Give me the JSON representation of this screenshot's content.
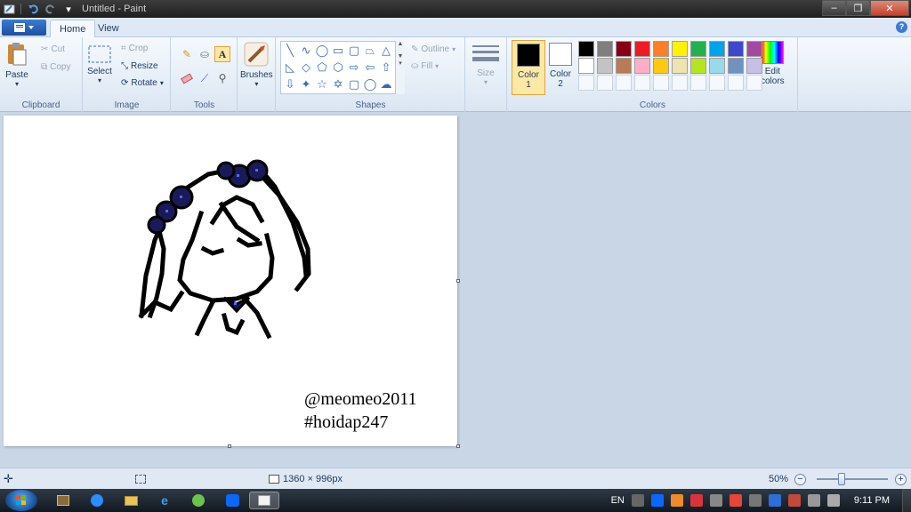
{
  "titlebar": {
    "title": "Untitled - Paint",
    "controls": [
      "minimize-icon",
      "restore-icon",
      "close-icon"
    ]
  },
  "tabs": [
    {
      "label": "Home",
      "active": true
    },
    {
      "label": "View",
      "active": false
    }
  ],
  "ribbon": {
    "clipboard": {
      "label": "Clipboard",
      "paste": "Paste",
      "cut": "Cut",
      "copy": "Copy"
    },
    "image": {
      "label": "Image",
      "select": "Select",
      "crop": "Crop",
      "resize": "Resize",
      "rotate": "Rotate"
    },
    "tools": {
      "label": "Tools",
      "items": [
        "pencil",
        "fill",
        "text",
        "eraser",
        "color-picker",
        "magnifier"
      ],
      "selected": "text"
    },
    "brushes": {
      "label": "Brushes"
    },
    "shapes": {
      "label": "Shapes",
      "outline": "Outline",
      "fill": "Fill"
    },
    "size": {
      "label": "Size"
    },
    "colors": {
      "label": "Colors",
      "color1": {
        "label": "Color",
        "num": "1",
        "value": "#000000"
      },
      "color2": {
        "label": "Color",
        "num": "2",
        "value": "#ffffff"
      },
      "edit_label": "Edit",
      "edit_label2": "colors",
      "palette": [
        "#000000",
        "#7f7f7f",
        "#880015",
        "#ed1c24",
        "#ff7f27",
        "#fff200",
        "#22b14c",
        "#00a2e8",
        "#3f48cc",
        "#a349a4",
        "#ffffff",
        "#c3c3c3",
        "#b97a57",
        "#ffaec9",
        "#ffc90e",
        "#efe4b0",
        "#b5e61d",
        "#99d9ea",
        "#7092be",
        "#c8bfe7"
      ]
    }
  },
  "canvas": {
    "caption_line1": "@meomeo2011",
    "caption_line2": "#hoidap247"
  },
  "statusbar": {
    "dimensions": "1360 × 996px",
    "zoom": "50%",
    "zoom_level": 0.5
  },
  "taskbar": {
    "language": "EN",
    "time": "9:11 PM"
  }
}
